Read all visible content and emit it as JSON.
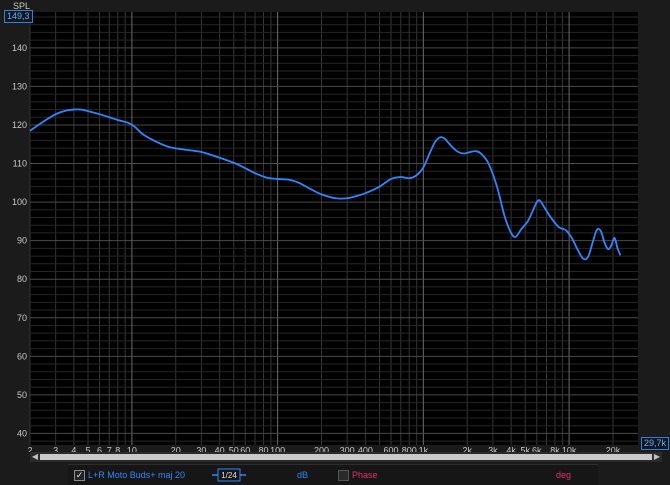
{
  "chart_data": {
    "type": "line",
    "ylabel": "SPL",
    "xscale": "log",
    "xlim": [
      2,
      29700
    ],
    "ylim": [
      37,
      149.3
    ],
    "grid": true,
    "y_ticks": [
      40,
      50,
      60,
      70,
      80,
      90,
      100,
      110,
      120,
      130,
      140
    ],
    "x_ticks": [
      {
        "v": 2,
        "label": "2"
      },
      {
        "v": 3,
        "label": "3"
      },
      {
        "v": 4,
        "label": "4"
      },
      {
        "v": 5,
        "label": "5"
      },
      {
        "v": 6,
        "label": "6"
      },
      {
        "v": 7,
        "label": "7"
      },
      {
        "v": 8,
        "label": "8"
      },
      {
        "v": 10,
        "label": "10"
      },
      {
        "v": 20,
        "label": "20"
      },
      {
        "v": 30,
        "label": "30"
      },
      {
        "v": 40,
        "label": "40"
      },
      {
        "v": 50,
        "label": "50"
      },
      {
        "v": 60,
        "label": "60"
      },
      {
        "v": 80,
        "label": "80"
      },
      {
        "v": 100,
        "label": "100"
      },
      {
        "v": 200,
        "label": "200"
      },
      {
        "v": 300,
        "label": "300"
      },
      {
        "v": 400,
        "label": "400"
      },
      {
        "v": 600,
        "label": "600"
      },
      {
        "v": 800,
        "label": "800"
      },
      {
        "v": 1000,
        "label": "1k"
      },
      {
        "v": 2000,
        "label": "2k"
      },
      {
        "v": 3000,
        "label": "3k"
      },
      {
        "v": 4000,
        "label": "4k"
      },
      {
        "v": 5000,
        "label": "5k"
      },
      {
        "v": 6000,
        "label": "6k"
      },
      {
        "v": 8000,
        "label": "8k"
      },
      {
        "v": 10000,
        "label": "10k"
      },
      {
        "v": 20000,
        "label": "20k"
      }
    ],
    "y_max_label": "149,3",
    "x_max_label": "29,7k",
    "series": [
      {
        "name": "L+R Moto Buds+ maj 20",
        "color": "#2f86ff",
        "points": [
          [
            2,
            118.5
          ],
          [
            2.5,
            121
          ],
          [
            3,
            122.8
          ],
          [
            3.5,
            123.7
          ],
          [
            4,
            124
          ],
          [
            4.5,
            124
          ],
          [
            5,
            123.6
          ],
          [
            6,
            122.8
          ],
          [
            7,
            122
          ],
          [
            8,
            121.3
          ],
          [
            9.5,
            120.5
          ],
          [
            10.5,
            119.5
          ],
          [
            12,
            117.5
          ],
          [
            15,
            115.5
          ],
          [
            18,
            114.3
          ],
          [
            22,
            113.7
          ],
          [
            30,
            113
          ],
          [
            40,
            111.5
          ],
          [
            50,
            110.2
          ],
          [
            60,
            108.8
          ],
          [
            70,
            107.5
          ],
          [
            85,
            106.3
          ],
          [
            100,
            106
          ],
          [
            120,
            105.8
          ],
          [
            140,
            105
          ],
          [
            170,
            103.3
          ],
          [
            200,
            102
          ],
          [
            250,
            101
          ],
          [
            300,
            101
          ],
          [
            350,
            101.6
          ],
          [
            400,
            102.3
          ],
          [
            500,
            104
          ],
          [
            600,
            106
          ],
          [
            700,
            106.5
          ],
          [
            800,
            106.2
          ],
          [
            900,
            107
          ],
          [
            1000,
            109
          ],
          [
            1100,
            112.5
          ],
          [
            1200,
            115.5
          ],
          [
            1300,
            116.8
          ],
          [
            1400,
            116.5
          ],
          [
            1500,
            115.2
          ],
          [
            1700,
            113.2
          ],
          [
            1900,
            112.6
          ],
          [
            2100,
            113
          ],
          [
            2300,
            113.2
          ],
          [
            2500,
            112.5
          ],
          [
            2800,
            110
          ],
          [
            3200,
            104
          ],
          [
            3600,
            96.5
          ],
          [
            4000,
            92
          ],
          [
            4300,
            91
          ],
          [
            4700,
            93
          ],
          [
            5200,
            95
          ],
          [
            5600,
            97.5
          ],
          [
            6000,
            100
          ],
          [
            6300,
            100.4
          ],
          [
            6800,
            98.5
          ],
          [
            7500,
            96
          ],
          [
            8500,
            93.5
          ],
          [
            9500,
            92.7
          ],
          [
            10500,
            90.5
          ],
          [
            11500,
            87.5
          ],
          [
            12500,
            85.3
          ],
          [
            13500,
            85.8
          ],
          [
            14500,
            89.5
          ],
          [
            15500,
            92.8
          ],
          [
            16500,
            92.5
          ],
          [
            17500,
            89.5
          ],
          [
            18500,
            87.8
          ],
          [
            19500,
            88.8
          ],
          [
            20500,
            90.7
          ],
          [
            21500,
            88
          ],
          [
            22500,
            86.2
          ]
        ]
      }
    ]
  },
  "legend": {
    "checkbox_mark": "✓",
    "series_label": "L+R Moto Buds+ maj 20",
    "smoothing_label": "1/24",
    "db_label": "dB",
    "phase_label": "Phase",
    "deg_label": "deg"
  },
  "colors": {
    "series": "#2f86ff",
    "phase": "#e0306a",
    "accent": "#3c7dd8"
  }
}
